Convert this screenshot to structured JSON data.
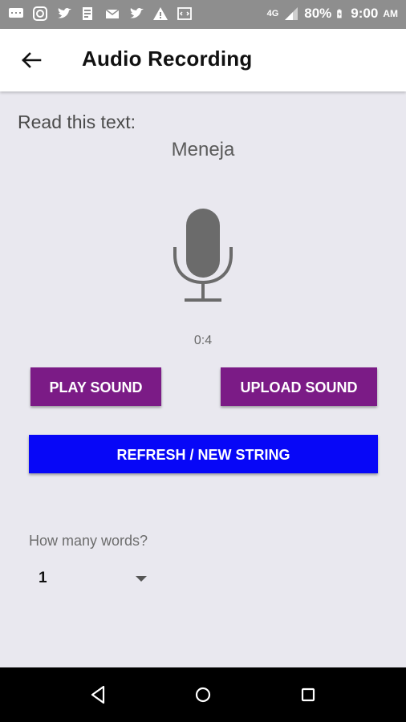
{
  "status_bar": {
    "icons": [
      "message-icon",
      "instagram-icon",
      "twitter-icon",
      "document-icon",
      "mail-icon",
      "twitter-icon",
      "alert-icon",
      "code-icon"
    ],
    "network": "4G",
    "battery": "80%",
    "time": "9:00",
    "ampm": "AM"
  },
  "app_bar": {
    "title": "Audio Recording",
    "back_icon": "arrow-back-icon"
  },
  "content": {
    "prompt": "Read this text:",
    "word": "Meneja",
    "mic_icon": "microphone-icon",
    "timer": "0:4"
  },
  "buttons": {
    "play": "PLAY SOUND",
    "upload": "UPLOAD SOUND",
    "refresh": "REFRESH / NEW STRING"
  },
  "words_select": {
    "label": "How many words?",
    "value": "1"
  },
  "nav_bar": {
    "back": "nav-back-icon",
    "home": "nav-home-icon",
    "recents": "nav-recents-icon"
  },
  "colors": {
    "purple": "#7b1b86",
    "blue": "#0707f7",
    "background": "#e9e8ef"
  }
}
